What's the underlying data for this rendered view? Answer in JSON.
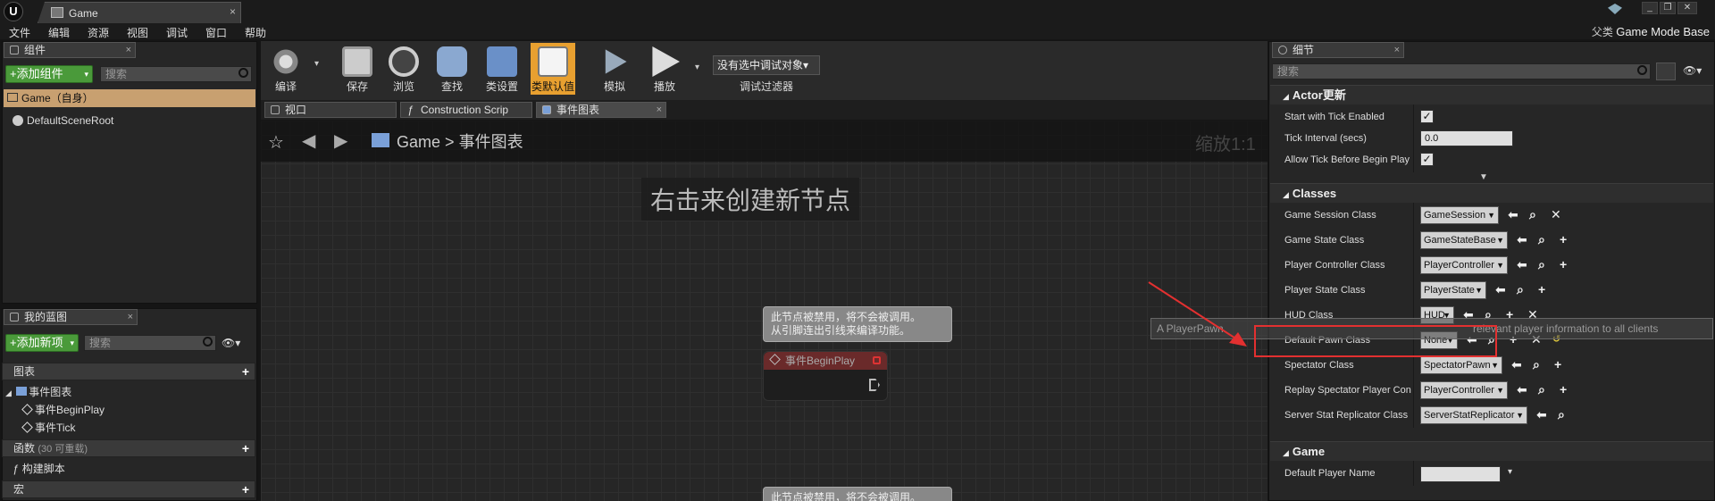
{
  "window": {
    "tab_title": "Game",
    "tab_close": "×",
    "parent_class_label": "父类",
    "parent_class_value": "Game Mode Base"
  },
  "menu": [
    "文件",
    "编辑",
    "资源",
    "视图",
    "调试",
    "窗口",
    "帮助"
  ],
  "components_panel": {
    "tab_label": "组件",
    "add_button": "+添加组件",
    "search_placeholder": "搜索",
    "root_item": "Game（自身）",
    "child_item": "DefaultSceneRoot"
  },
  "my_blueprint": {
    "tab_label": "我的蓝图",
    "add_button": "+添加新项",
    "search_placeholder": "搜索",
    "graphs_header": "图表",
    "event_graph": "事件图表",
    "events": [
      "事件BeginPlay",
      "事件Tick"
    ],
    "functions_header": "函数",
    "functions_count": "(30 可重载)",
    "construction_script": "构建脚本",
    "macros_header": "宏"
  },
  "toolbar": {
    "compile": "编译",
    "save": "保存",
    "browse": "浏览",
    "find": "查找",
    "class_settings": "类设置",
    "class_defaults": "类默认值",
    "simulate": "模拟",
    "play": "播放",
    "debug_object": "没有选中调试对象",
    "debug_filter": "调试过滤器"
  },
  "editor_tabs": [
    {
      "label": "视口"
    },
    {
      "label": "Construction Scrip"
    },
    {
      "label": "事件图表"
    }
  ],
  "graph": {
    "breadcrumb_root": "Game",
    "breadcrumb_sep": ">",
    "breadcrumb_current": "事件图表",
    "zoom": "缩放1:1",
    "hint": "右击来创建新节点",
    "node_tip_line1": "此节点被禁用，将不会被调用。",
    "node_tip_line2": "从引脚连出引线来编译功能。",
    "node_title": "事件BeginPlay",
    "node_tip2_line1": "此节点被禁用，将不会被调用。"
  },
  "details": {
    "tab_label": "细节",
    "search_placeholder": "搜索",
    "tooltip_fragment": "A PlayerPawn",
    "tooltip_fragment_right": "relevant player information to all clients",
    "actor_section": "Actor更新",
    "actor_props": [
      {
        "label": "Start with Tick Enabled",
        "checked": true
      },
      {
        "label": "Tick Interval (secs)",
        "value": "0.0"
      },
      {
        "label": "Allow Tick Before Begin Play",
        "checked": true
      }
    ],
    "classes_section": "Classes",
    "class_props": [
      {
        "label": "Game Session Class",
        "value": "GameSession",
        "actions": [
          "back-arrow",
          "browse",
          "clear"
        ]
      },
      {
        "label": "Game State Class",
        "value": "GameStateBase",
        "actions": [
          "back-arrow",
          "browse",
          "add"
        ]
      },
      {
        "label": "Player Controller Class",
        "value": "PlayerController",
        "actions": [
          "back-arrow",
          "browse",
          "add"
        ]
      },
      {
        "label": "Player State Class",
        "value": "PlayerState",
        "actions": [
          "back-arrow",
          "browse",
          "add"
        ]
      },
      {
        "label": "HUD Class",
        "value": "HUD",
        "actions": [
          "back-arrow",
          "browse",
          "add",
          "clear"
        ]
      },
      {
        "label": "Default Pawn Class",
        "value": "None",
        "actions": [
          "back-arrow",
          "browse",
          "add",
          "clear",
          "reset"
        ]
      },
      {
        "label": "Spectator Class",
        "value": "SpectatorPawn",
        "actions": [
          "back-arrow",
          "browse",
          "add"
        ]
      },
      {
        "label": "Replay Spectator Player Contr",
        "value": "PlayerController",
        "actions": [
          "back-arrow",
          "browse",
          "add"
        ]
      },
      {
        "label": "Server Stat Replicator Class",
        "value": "ServerStatReplicator",
        "actions": [
          "back-arrow",
          "browse"
        ]
      }
    ],
    "game_section": "Game",
    "game_props": [
      {
        "label": "Default Player Name",
        "value": ""
      }
    ]
  },
  "colors": {
    "accent_green": "#4a9a3a",
    "class_defaults_highlight": "#e8a030",
    "annotation_red": "#e33030"
  }
}
